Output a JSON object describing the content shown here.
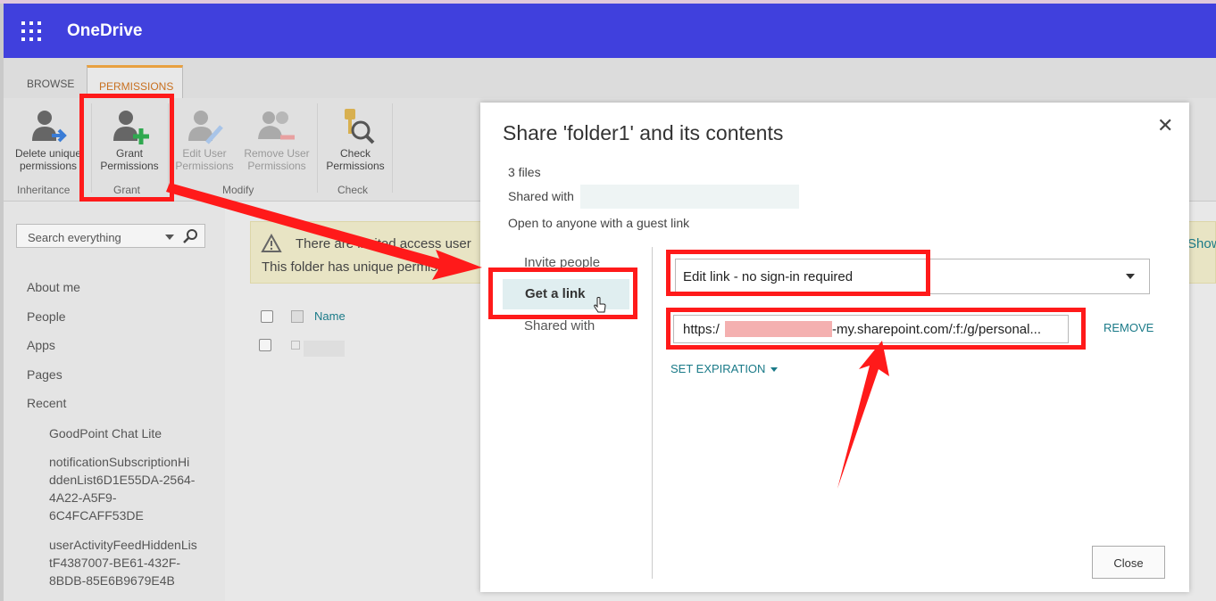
{
  "suite": {
    "app_name": "OneDrive"
  },
  "ribbon": {
    "tabs": [
      {
        "label": "BROWSE"
      },
      {
        "label": "PERMISSIONS"
      }
    ],
    "buttons": {
      "delete_unique": "Delete unique permissions",
      "grant": "Grant Permissions",
      "edit_user": "Edit User Permissions",
      "remove_user": "Remove User Permissions",
      "check": "Check Permissions"
    },
    "groups": {
      "inheritance": "Inheritance",
      "grant": "Grant",
      "modify": "Modify",
      "check": "Check"
    }
  },
  "leftnav": {
    "search_placeholder": "Search everything",
    "items": [
      "About me",
      "People",
      "Apps",
      "Pages",
      "Recent"
    ],
    "recent": [
      "GoodPoint Chat Lite",
      "notificationSubscriptionHiddenList6D1E55DA-2564-4A22-A5F9-6C4FCAFF53DE",
      "userActivityFeedHiddenListF4387007-BE61-432F-8BDB-85E6B9679E4B"
    ],
    "recent_lines": [
      [
        "GoodPoint Chat Lite"
      ],
      [
        "notificationSubscriptionHi",
        "ddenList6D1E55DA-2564-",
        "4A22-A5F9-",
        "6C4FCAFF53DE"
      ],
      [
        "userActivityFeedHiddenLis",
        "tF4387007-BE61-432F-",
        "8BDB-85E6B9679E4B"
      ]
    ]
  },
  "content": {
    "banner_line1": "There are limited access user",
    "banner_line2": "This folder has unique permissi",
    "banner_show": "Show",
    "column_name": "Name"
  },
  "dialog": {
    "title": "Share 'folder1' and its contents",
    "files": "3 files",
    "shared_with": "Shared with",
    "open_to": "Open to anyone with a guest link",
    "nav": {
      "invite": "Invite people",
      "get_link": "Get a link",
      "shared_with": "Shared with"
    },
    "link_type": "Edit link - no sign-in required",
    "link_url_prefix": "https:/",
    "link_url_suffix": "-my.sharepoint.com/:f:/g/personal...",
    "remove": "REMOVE",
    "set_expiration": "SET EXPIRATION",
    "close": "Close"
  },
  "colors": {
    "suite_bar": "#4040dd",
    "accent_teal": "#1a7a88",
    "annotation_red": "#ff1a1a"
  }
}
